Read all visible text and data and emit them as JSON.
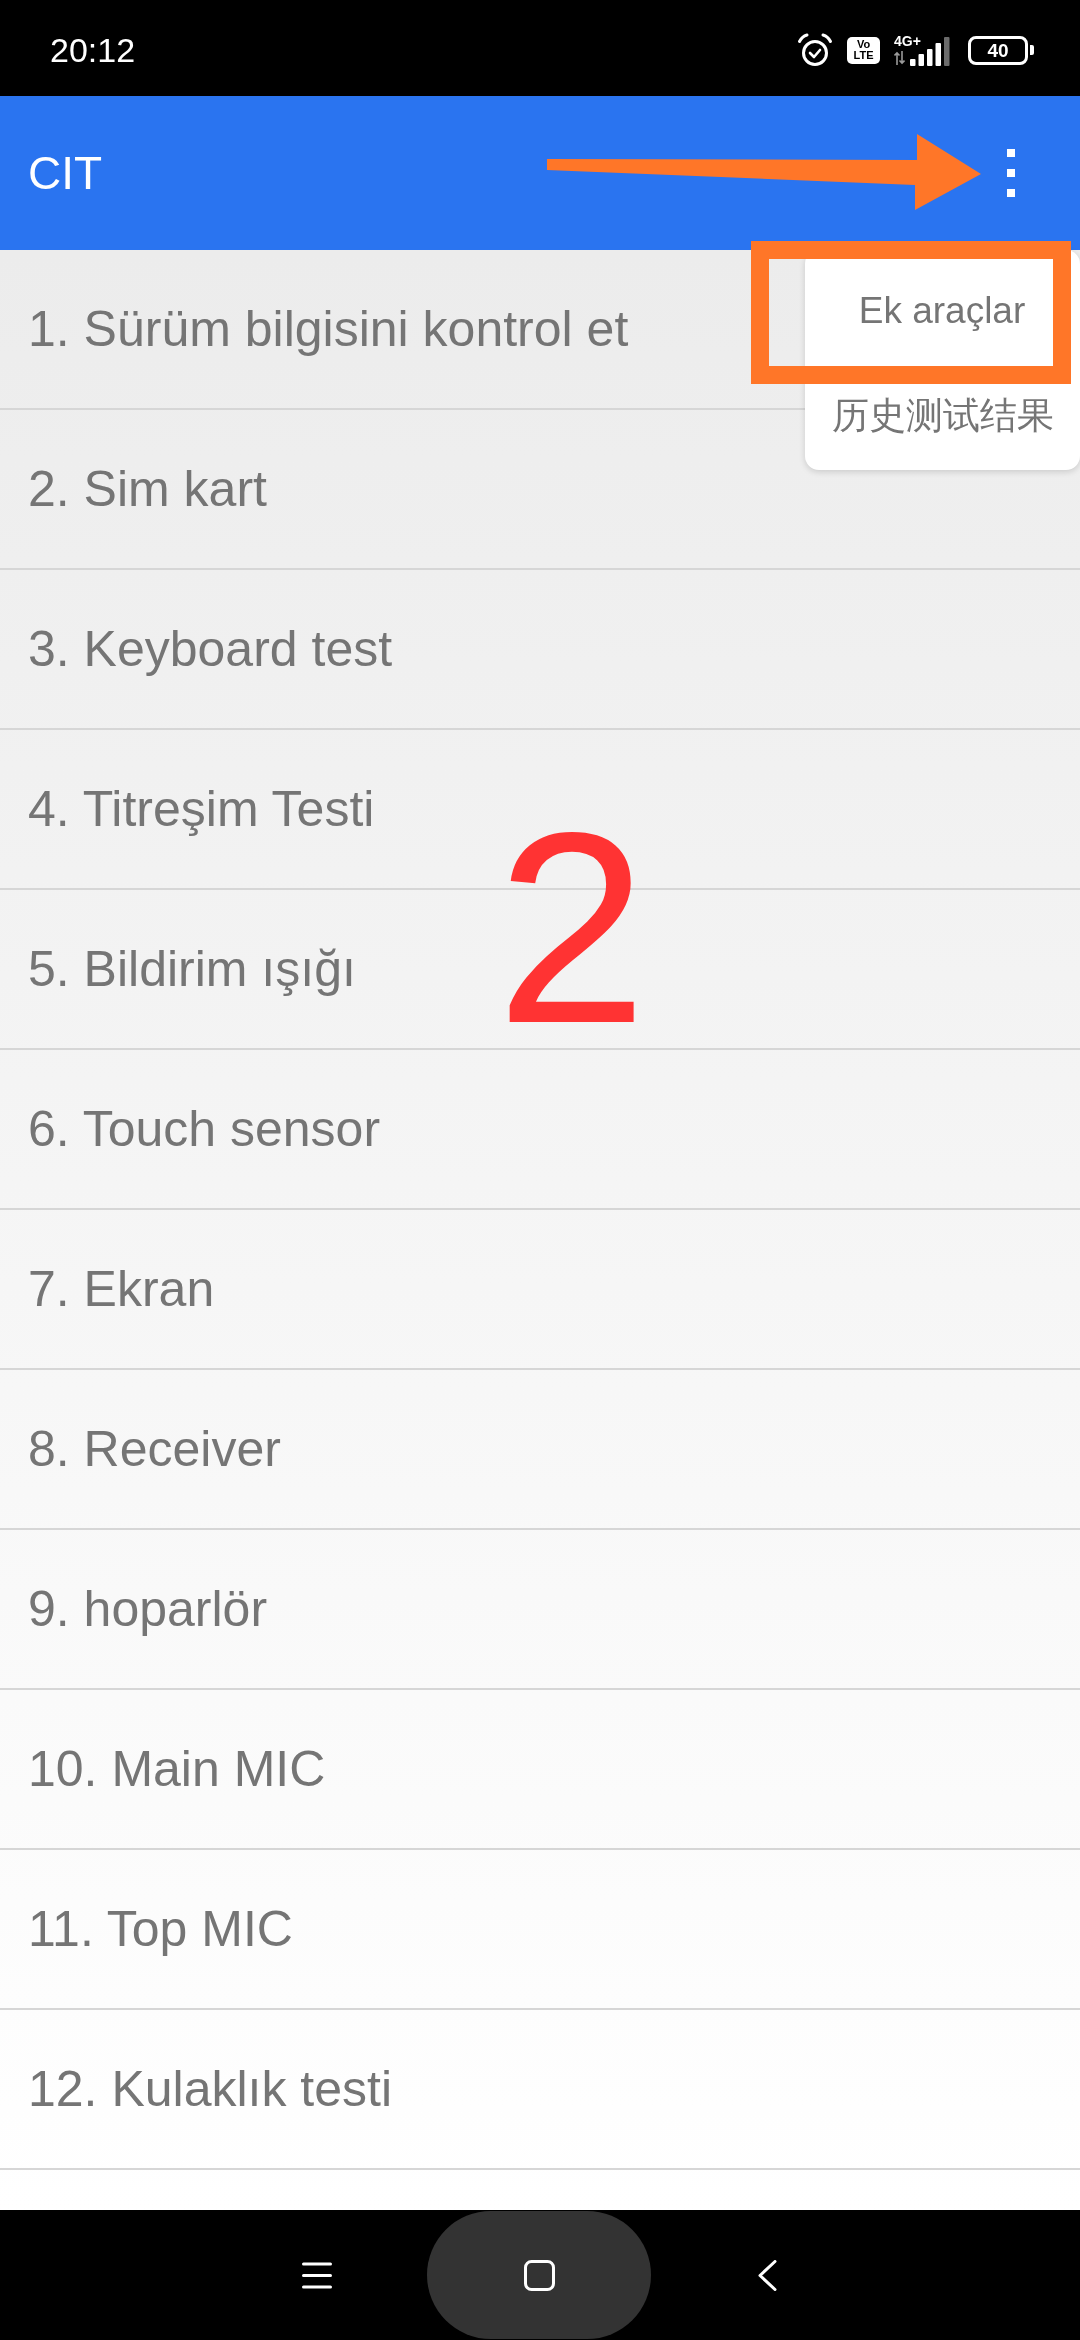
{
  "status_bar": {
    "time": "20:12",
    "volte_top": "Vo",
    "volte_bottom": "LTE",
    "network_type": "4G+",
    "battery": "40"
  },
  "app_bar": {
    "title": "CIT"
  },
  "list": {
    "items": [
      {
        "label": "1. Sürüm bilgisini kontrol et"
      },
      {
        "label": "2. Sim kart"
      },
      {
        "label": "3. Keyboard test"
      },
      {
        "label": "4. Titreşim Testi"
      },
      {
        "label": "5. Bildirim ışığı"
      },
      {
        "label": "6. Touch sensor"
      },
      {
        "label": "7. Ekran"
      },
      {
        "label": "8. Receiver"
      },
      {
        "label": "9. hoparlör"
      },
      {
        "label": "10. Main MIC"
      },
      {
        "label": "11. Top MIC"
      },
      {
        "label": "12. Kulaklık testi"
      }
    ]
  },
  "overflow_menu": {
    "items": [
      {
        "label": "Ek araçlar",
        "highlighted": true
      },
      {
        "label": "历史测试结果",
        "highlighted": false
      }
    ]
  },
  "annotation": {
    "step_number": "2"
  }
}
